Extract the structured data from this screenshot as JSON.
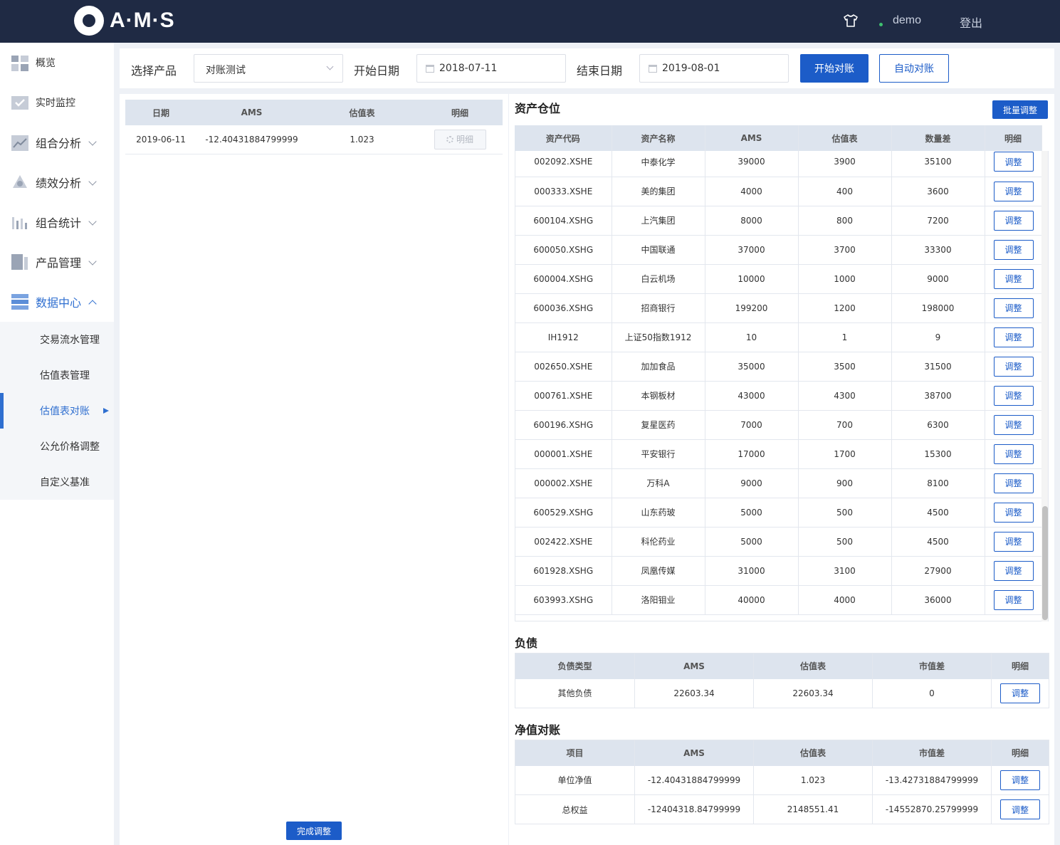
{
  "header": {
    "logo_text": "A·M·S",
    "user": "demo",
    "logout": "登出"
  },
  "sidebar": {
    "items": [
      {
        "label": "概览"
      },
      {
        "label": "实时监控"
      },
      {
        "label": "组合分析"
      },
      {
        "label": "绩效分析"
      },
      {
        "label": "组合统计"
      },
      {
        "label": "产品管理"
      },
      {
        "label": "数据中心"
      }
    ],
    "submenu": [
      {
        "label": "交易流水管理"
      },
      {
        "label": "估值表管理"
      },
      {
        "label": "估值表对账"
      },
      {
        "label": "公允价格调整"
      },
      {
        "label": "自定义基准"
      }
    ]
  },
  "filter": {
    "product_label": "选择产品",
    "product_value": "对账测试",
    "start_label": "开始日期",
    "start_value": "2018-07-11",
    "end_label": "结束日期",
    "end_value": "2019-08-01",
    "start_button": "开始对账",
    "auto_button": "自动对账"
  },
  "recon": {
    "headers": [
      "日期",
      "AMS",
      "估值表",
      "明细"
    ],
    "rows": [
      {
        "date": "2019-06-11",
        "ams": "-12.40431884799999",
        "val": "1.023",
        "detail": "明细"
      }
    ],
    "finish_button": "完成调整"
  },
  "assets": {
    "title": "资产仓位",
    "batch_button": "批量调整",
    "headers": [
      "资产代码",
      "资产名称",
      "AMS",
      "估值表",
      "数量差",
      "明细"
    ],
    "adjust_label": "调整",
    "rows": [
      [
        "002092.XSHE",
        "中泰化学",
        "39000",
        "3900",
        "35100"
      ],
      [
        "000333.XSHE",
        "美的集团",
        "4000",
        "400",
        "3600"
      ],
      [
        "600104.XSHG",
        "上汽集团",
        "8000",
        "800",
        "7200"
      ],
      [
        "600050.XSHG",
        "中国联通",
        "37000",
        "3700",
        "33300"
      ],
      [
        "600004.XSHG",
        "白云机场",
        "10000",
        "1000",
        "9000"
      ],
      [
        "600036.XSHG",
        "招商银行",
        "199200",
        "1200",
        "198000"
      ],
      [
        "IH1912",
        "上证50指数1912",
        "10",
        "1",
        "9"
      ],
      [
        "002650.XSHE",
        "加加食品",
        "35000",
        "3500",
        "31500"
      ],
      [
        "000761.XSHE",
        "本钢板材",
        "43000",
        "4300",
        "38700"
      ],
      [
        "600196.XSHG",
        "复星医药",
        "7000",
        "700",
        "6300"
      ],
      [
        "000001.XSHE",
        "平安银行",
        "17000",
        "1700",
        "15300"
      ],
      [
        "000002.XSHE",
        "万科A",
        "9000",
        "900",
        "8100"
      ],
      [
        "600529.XSHG",
        "山东药玻",
        "5000",
        "500",
        "4500"
      ],
      [
        "002422.XSHE",
        "科伦药业",
        "5000",
        "500",
        "4500"
      ],
      [
        "601928.XSHG",
        "凤凰传媒",
        "31000",
        "3100",
        "27900"
      ],
      [
        "603993.XSHG",
        "洛阳钼业",
        "40000",
        "4000",
        "36000"
      ]
    ]
  },
  "liabilities": {
    "title": "负债",
    "headers": [
      "负债类型",
      "AMS",
      "估值表",
      "市值差",
      "明细"
    ],
    "rows": [
      [
        "其他负债",
        "22603.34",
        "22603.34",
        "0"
      ]
    ]
  },
  "nav": {
    "title": "净值对账",
    "headers": [
      "项目",
      "AMS",
      "估值表",
      "市值差",
      "明细"
    ],
    "rows": [
      [
        "单位净值",
        "-12.40431884799999",
        "1.023",
        "-13.42731884799999"
      ],
      [
        "总权益",
        "-12404318.84799999",
        "2148551.41",
        "-14552870.25799999"
      ]
    ]
  },
  "colors": {
    "primary": "#1c5cc8",
    "header_bg": "#1f2a44",
    "table_head": "#dde4ee",
    "active": "#2f6fd0"
  }
}
